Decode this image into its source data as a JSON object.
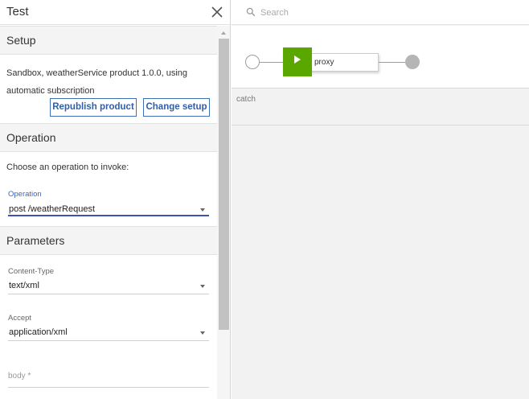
{
  "panel": {
    "title": "Test",
    "close_icon": "close-icon"
  },
  "setup": {
    "heading": "Setup",
    "description": "Sandbox, weatherService product 1.0.0, using automatic subscription",
    "republish_label": "Republish product",
    "change_label": "Change setup"
  },
  "operation": {
    "heading": "Operation",
    "prompt": "Choose an operation to invoke:",
    "field_label": "Operation",
    "selected": "post /weatherRequest"
  },
  "parameters": {
    "heading": "Parameters",
    "content_type_label": "Content-Type",
    "content_type_value": "text/xml",
    "accept_label": "Accept",
    "accept_value": "application/xml",
    "body_label": "body *"
  },
  "canvas": {
    "search_placeholder": "Search",
    "search_icon": "search-icon",
    "node_label": "proxy",
    "node_icon": "play-icon",
    "catch_label": "catch"
  },
  "colors": {
    "accent": "#3f51b5",
    "button_text": "#2f5fa8",
    "node_green": "#5aa700"
  }
}
